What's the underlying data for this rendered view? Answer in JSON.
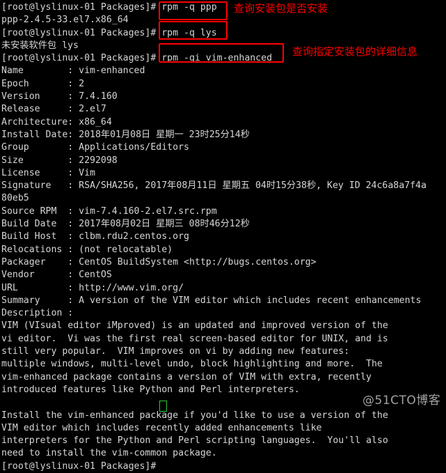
{
  "terminal": {
    "background": "#000000",
    "foreground": "#d6d6d6",
    "accent_red": "#fb0000",
    "cursor_color": "#31cc31",
    "prompt": "[root@lyslinux-01 Packages]#",
    "lines": [
      {
        "id": "l01",
        "text": "[root@lyslinux-01 Packages]# rpm -q ppp"
      },
      {
        "id": "l02",
        "text": "ppp-2.4.5-33.el7.x86_64"
      },
      {
        "id": "l03",
        "text": "[root@lyslinux-01 Packages]# rpm -q lys"
      },
      {
        "id": "l04",
        "text": "未安装软件包 lys"
      },
      {
        "id": "l05",
        "text": "[root@lyslinux-01 Packages]# rpm -qi vim-enhanced"
      },
      {
        "id": "l06",
        "text": "Name        : vim-enhanced"
      },
      {
        "id": "l07",
        "text": "Epoch       : 2"
      },
      {
        "id": "l08",
        "text": "Version     : 7.4.160"
      },
      {
        "id": "l09",
        "text": "Release     : 2.el7"
      },
      {
        "id": "l10",
        "text": "Architecture: x86_64"
      },
      {
        "id": "l11",
        "text": "Install Date: 2018年01月08日 星期一 23时25分14秒"
      },
      {
        "id": "l12",
        "text": "Group       : Applications/Editors"
      },
      {
        "id": "l13",
        "text": "Size        : 2292098"
      },
      {
        "id": "l14",
        "text": "License     : Vim"
      },
      {
        "id": "l15",
        "text": "Signature   : RSA/SHA256, 2017年08月11日 星期五 04时15分38秒, Key ID 24c6a8a7f4a"
      },
      {
        "id": "l16",
        "text": "80eb5"
      },
      {
        "id": "l17",
        "text": "Source RPM  : vim-7.4.160-2.el7.src.rpm"
      },
      {
        "id": "l18",
        "text": "Build Date  : 2017年08月02日 星期三 08时46分12秒"
      },
      {
        "id": "l19",
        "text": "Build Host  : clbm.rdu2.centos.org"
      },
      {
        "id": "l20",
        "text": "Relocations : (not relocatable)"
      },
      {
        "id": "l21",
        "text": "Packager    : CentOS BuildSystem <http://bugs.centos.org>"
      },
      {
        "id": "l22",
        "text": "Vendor      : CentOS"
      },
      {
        "id": "l23",
        "text": "URL         : http://www.vim.org/"
      },
      {
        "id": "l24",
        "text": "Summary     : A version of the VIM editor which includes recent enhancements"
      },
      {
        "id": "l25",
        "text": "Description :"
      },
      {
        "id": "l26",
        "text": "VIM (VIsual editor iMproved) is an updated and improved version of the"
      },
      {
        "id": "l27",
        "text": "vi editor.  Vi was the first real screen-based editor for UNIX, and is"
      },
      {
        "id": "l28",
        "text": "still very popular.  VIM improves on vi by adding new features:"
      },
      {
        "id": "l29",
        "text": "multiple windows, multi-level undo, block highlighting and more.  The"
      },
      {
        "id": "l30",
        "text": "vim-enhanced package contains a version of VIM with extra, recently"
      },
      {
        "id": "l31",
        "text": "introduced features like Python and Perl interpreters."
      },
      {
        "id": "l32",
        "text": ""
      },
      {
        "id": "l33",
        "text": "Install the vim-enhanced package if you'd like to use a version of the"
      },
      {
        "id": "l34",
        "text": "VIM editor which includes recently added enhancements like"
      },
      {
        "id": "l35",
        "text": "interpreters for the Python and Perl scripting languages.  You'll also"
      },
      {
        "id": "l36",
        "text": "need to install the vim-common package."
      },
      {
        "id": "l37",
        "text": "[root@lyslinux-01 Packages]#"
      }
    ]
  },
  "annotations": [
    {
      "id": "a1",
      "boxed_command": "rpm -q ppp",
      "note": "查询安装包是否安装",
      "color": "#fb0000"
    },
    {
      "id": "a2",
      "boxed_command": "rpm -q lys",
      "note": "",
      "color": "#fb0000"
    },
    {
      "id": "a3",
      "boxed_command": "rpm -qi vim-enhanced",
      "note": "查询指定安装包的详细信息",
      "color": "#fb0000"
    }
  ],
  "watermark": {
    "text": "@51CTO博客"
  }
}
